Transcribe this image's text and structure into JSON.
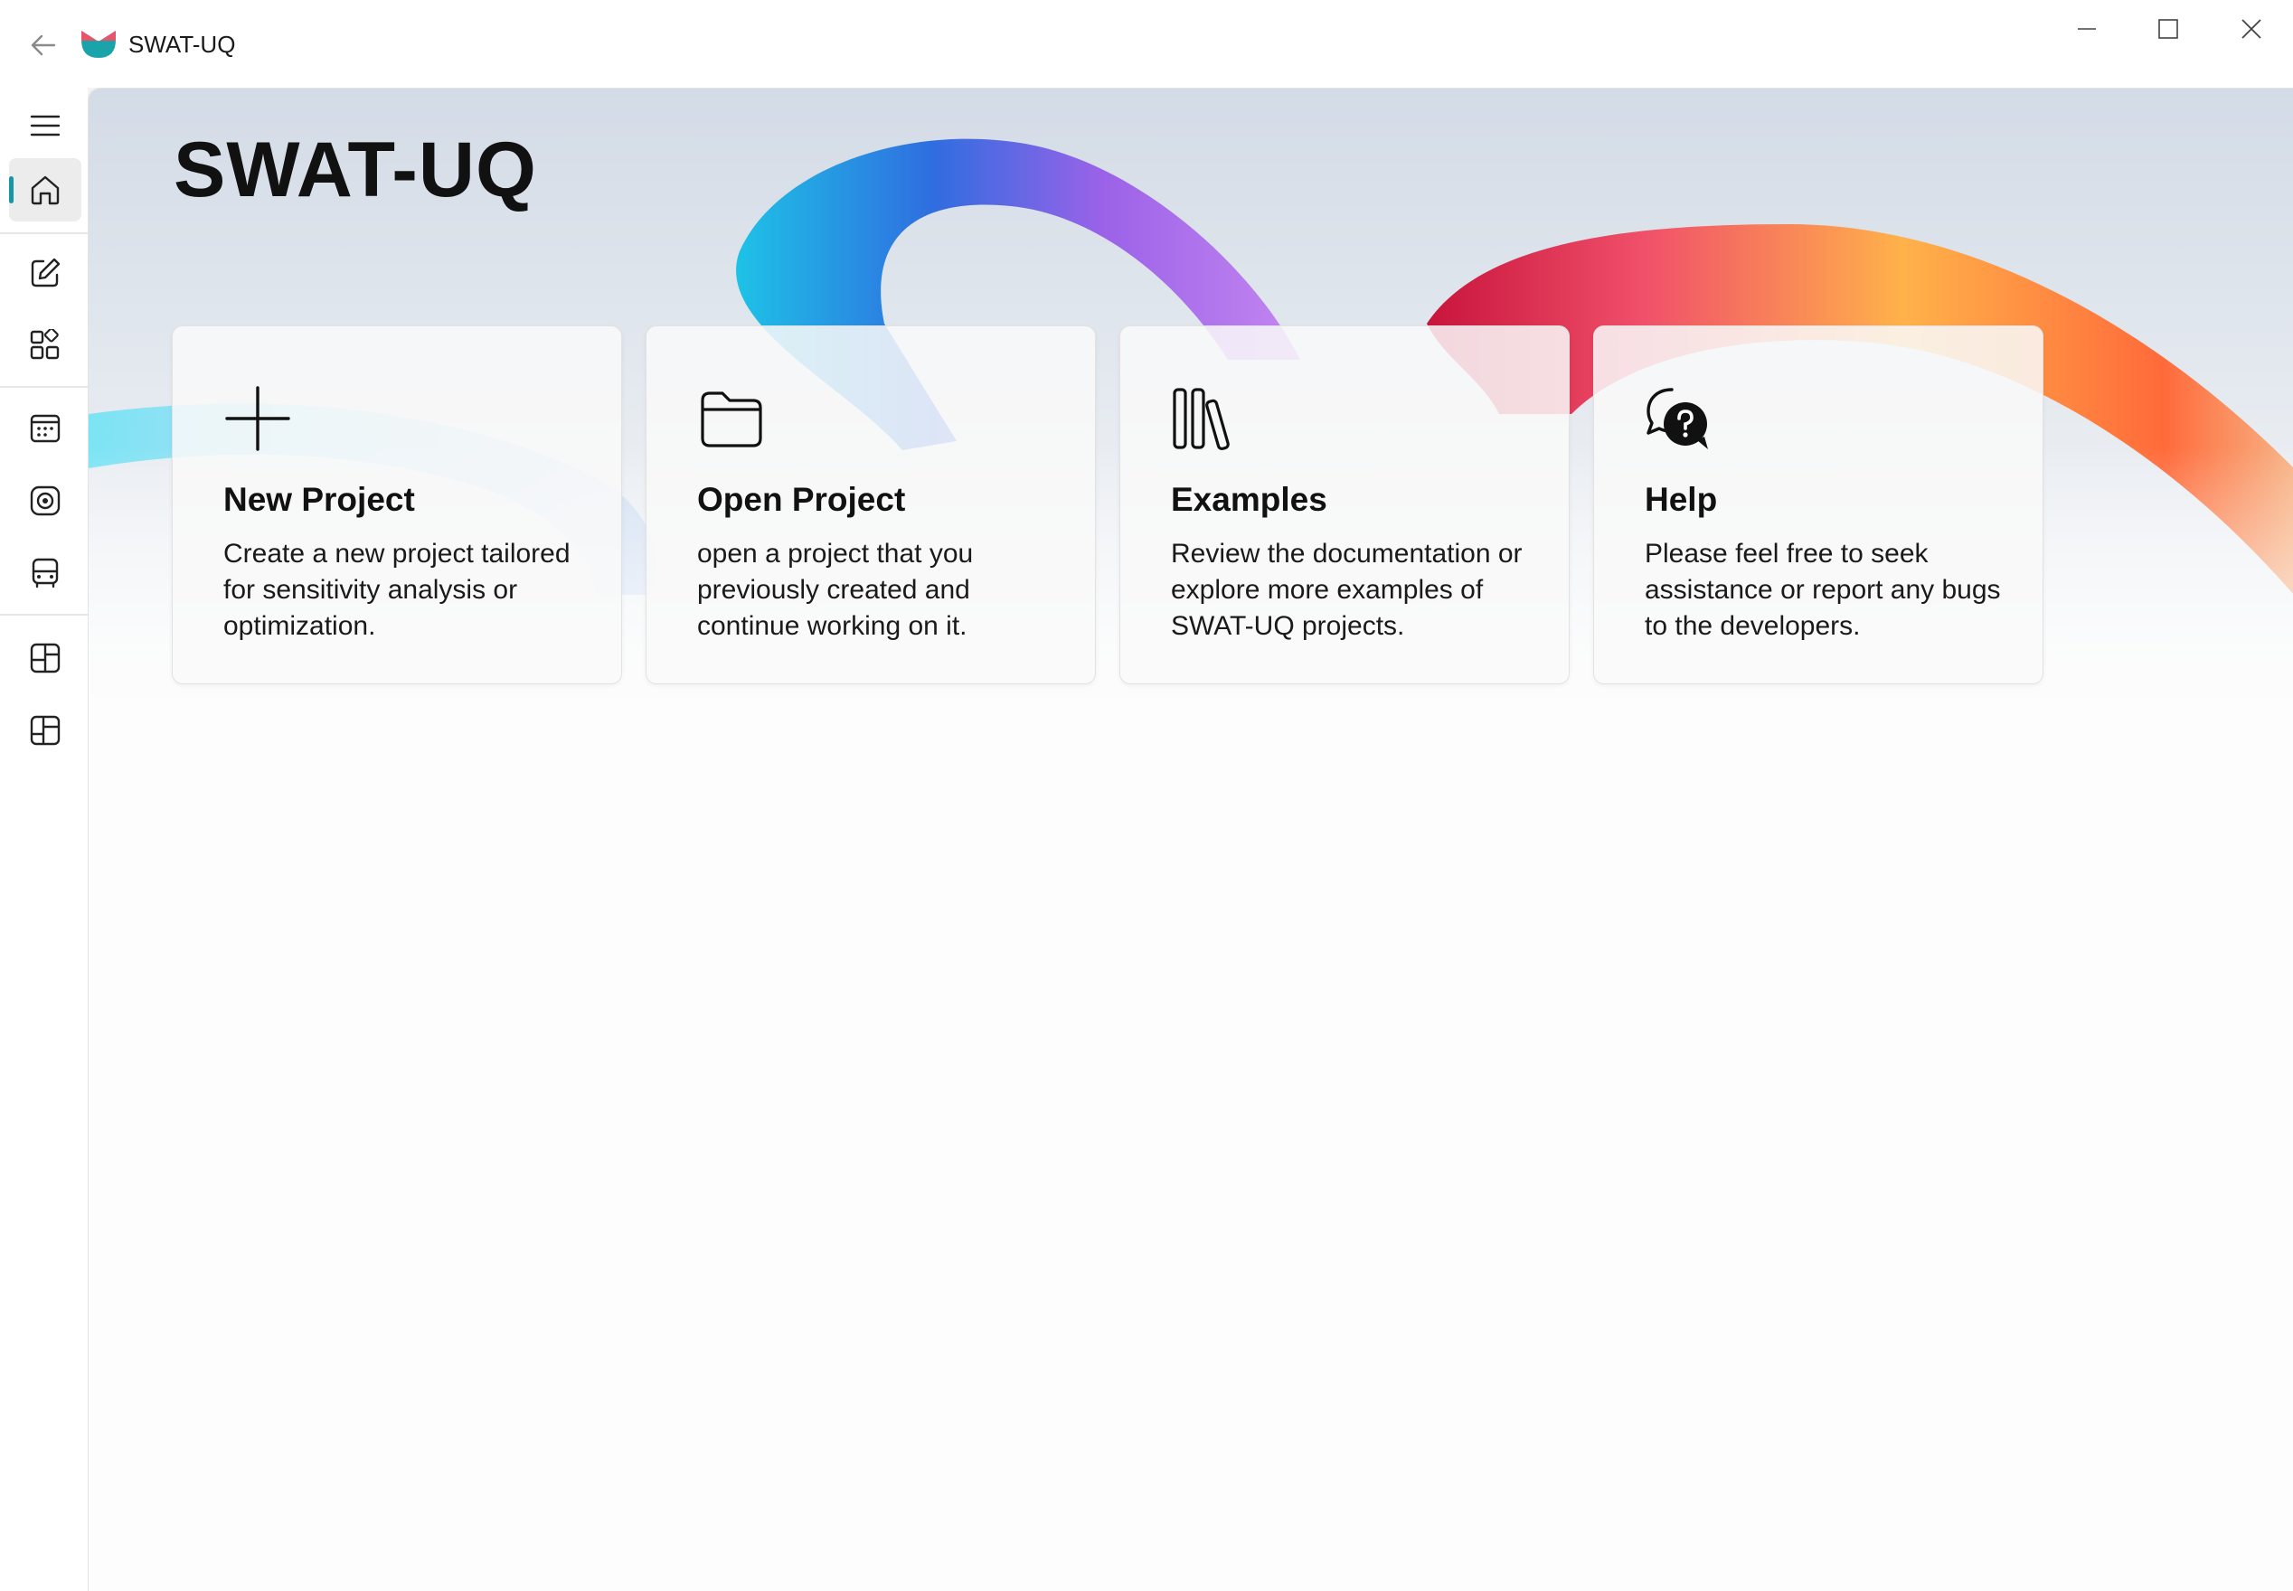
{
  "window": {
    "title": "SWAT-UQ",
    "back_icon": "arrow-left-icon",
    "minimize_icon": "minimize-icon",
    "maximize_icon": "maximize-icon",
    "close_icon": "close-icon"
  },
  "nav": {
    "accent_color": "#1797a6",
    "items": [
      {
        "icon": "hamburger-menu-icon"
      },
      {
        "icon": "home-icon",
        "selected": true
      },
      {
        "icon": "edit-icon"
      },
      {
        "icon": "apps-grid-icon"
      },
      {
        "icon": "calendar-icon"
      },
      {
        "icon": "target-icon"
      },
      {
        "icon": "bus-icon"
      },
      {
        "icon": "layout-icon"
      },
      {
        "icon": "layout-alt-icon"
      }
    ]
  },
  "home": {
    "title": "SWAT-UQ",
    "cards": [
      {
        "icon": "plus-icon",
        "title": "New Project",
        "description": "Create a new project tailored for sensitivity analysis or optimization."
      },
      {
        "icon": "folder-icon",
        "title": "Open Project",
        "description": "open a project that you previously created and continue working on it."
      },
      {
        "icon": "library-icon",
        "title": "Examples",
        "description": "Review the documentation or explore more examples of SWAT-UQ projects."
      },
      {
        "icon": "chat-help-icon",
        "title": "Help",
        "description": "Please feel free to seek assistance or report any bugs to the developers."
      }
    ]
  }
}
